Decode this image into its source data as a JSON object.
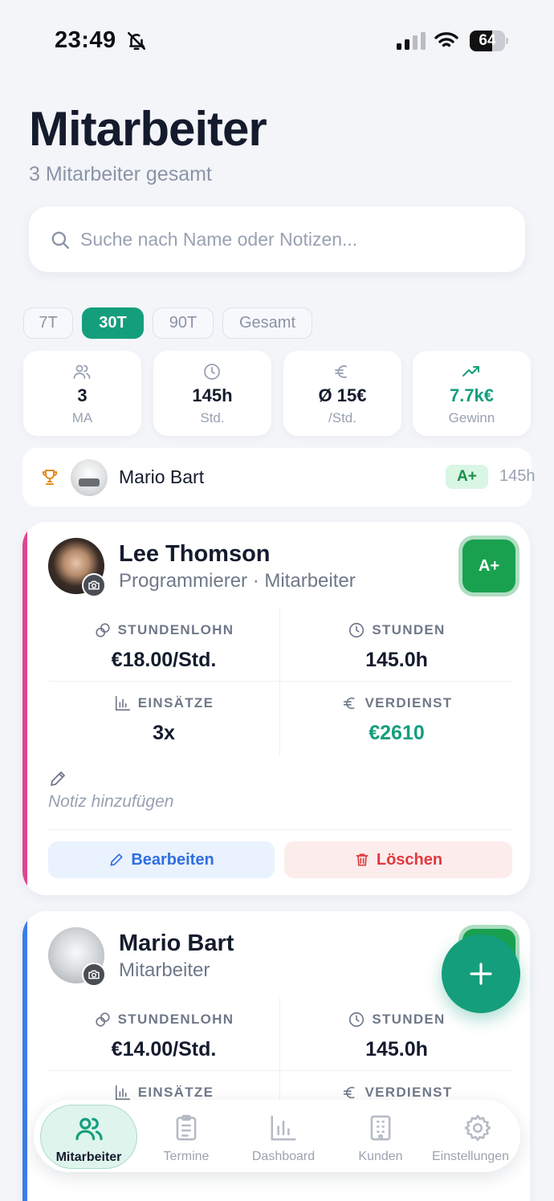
{
  "status_bar": {
    "time": "23:49",
    "battery": "64",
    "battery_level": 0.64
  },
  "header": {
    "title": "Mitarbeiter",
    "subtitle": "3 Mitarbeiter gesamt"
  },
  "search": {
    "placeholder": "Suche nach Name oder Notizen...",
    "value": ""
  },
  "filters": [
    {
      "label": "7T",
      "active": false
    },
    {
      "label": "30T",
      "active": true
    },
    {
      "label": "90T",
      "active": false
    },
    {
      "label": "Gesamt",
      "active": false
    }
  ],
  "stats": [
    {
      "icon": "users-icon",
      "value": "3",
      "label": "MA"
    },
    {
      "icon": "clock-icon",
      "value": "145h",
      "label": "Std."
    },
    {
      "icon": "euro-icon",
      "value": "Ø 15€",
      "label": "/Std."
    },
    {
      "icon": "trending-up-icon",
      "value": "7.7k€",
      "label": "Gewinn"
    }
  ],
  "top_performer": {
    "name": "Mario Bart",
    "grade": "A+",
    "hours": "145h"
  },
  "employees": [
    {
      "name": "Lee Thomson",
      "role": "Programmierer · Mitarbeiter",
      "grade": "A+",
      "accent": "#e0458f",
      "metrics": {
        "rate_label": "STUNDENLOHN",
        "rate": "€18.00/Std.",
        "hours_label": "STUNDEN",
        "hours": "145.0h",
        "jobs_label": "EINSÄTZE",
        "jobs": "3x",
        "earnings_label": "VERDIENST",
        "earnings": "€2610"
      },
      "note_placeholder": "Notiz hinzufügen",
      "edit_label": "Bearbeiten",
      "delete_label": "Löschen"
    },
    {
      "name": "Mario Bart",
      "role": "Mitarbeiter",
      "grade": "A+",
      "accent": "#3b7de8",
      "metrics": {
        "rate_label": "STUNDENLOHN",
        "rate": "€14.00/Std.",
        "hours_label": "STUNDEN",
        "hours": "145.0h",
        "jobs_label": "EINSÄTZE",
        "earnings_label": "VERDIENST"
      }
    }
  ],
  "nav": [
    {
      "label": "Mitarbeiter",
      "icon": "users-icon",
      "active": true
    },
    {
      "label": "Termine",
      "icon": "clipboard-icon",
      "active": false
    },
    {
      "label": "Dashboard",
      "icon": "bar-chart-icon",
      "active": false
    },
    {
      "label": "Kunden",
      "icon": "building-icon",
      "active": false
    },
    {
      "label": "Einstellungen",
      "icon": "gear-icon",
      "active": false
    }
  ],
  "colors": {
    "primary": "#149e7c",
    "grade": "#1aa14f",
    "edit": "#2f6fe0",
    "delete": "#e0393e"
  }
}
